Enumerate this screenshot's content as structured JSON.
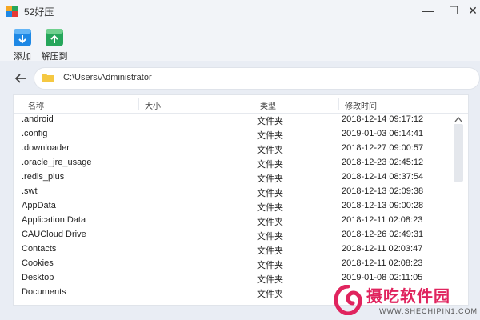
{
  "window": {
    "title": "52好压",
    "min": "—",
    "max": "☐",
    "close": "✕"
  },
  "toolbar": {
    "add_label": "添加",
    "extract_label": "解压到"
  },
  "address": {
    "path": "C:\\Users\\Administrator"
  },
  "table": {
    "headers": {
      "name": "名称",
      "size": "大小",
      "type": "类型",
      "modified": "修改时间"
    },
    "rows": [
      {
        "name": ".android",
        "type": "文件夹",
        "modified": "2018-12-14 09:17:12"
      },
      {
        "name": ".config",
        "type": "文件夹",
        "modified": "2019-01-03 06:14:41"
      },
      {
        "name": ".downloader",
        "type": "文件夹",
        "modified": "2018-12-27 09:00:57"
      },
      {
        "name": ".oracle_jre_usage",
        "type": "文件夹",
        "modified": "2018-12-23 02:45:12"
      },
      {
        "name": ".redis_plus",
        "type": "文件夹",
        "modified": "2018-12-14 08:37:54"
      },
      {
        "name": ".swt",
        "type": "文件夹",
        "modified": "2018-12-13 02:09:38"
      },
      {
        "name": "AppData",
        "type": "文件夹",
        "modified": "2018-12-13 09:00:28"
      },
      {
        "name": "Application Data",
        "type": "文件夹",
        "modified": "2018-12-11 02:08:23"
      },
      {
        "name": "CAUCloud Drive",
        "type": "文件夹",
        "modified": "2018-12-26 02:49:31"
      },
      {
        "name": "Contacts",
        "type": "文件夹",
        "modified": "2018-12-11 02:03:47"
      },
      {
        "name": "Cookies",
        "type": "文件夹",
        "modified": "2018-12-11 02:08:23"
      },
      {
        "name": "Desktop",
        "type": "文件夹",
        "modified": "2019-01-08 02:11:05"
      },
      {
        "name": "Documents",
        "type": "文件夹",
        "modified": ""
      }
    ]
  },
  "watermark": {
    "text": "摄吃软件园",
    "sub": "WWW.SHECHIPIN1.COM"
  },
  "colors": {
    "accent_blue": "#1e88e5",
    "accent_green": "#26a65b",
    "folder_yellow": "#f5c842",
    "watermark_pink": "#e0245e"
  }
}
